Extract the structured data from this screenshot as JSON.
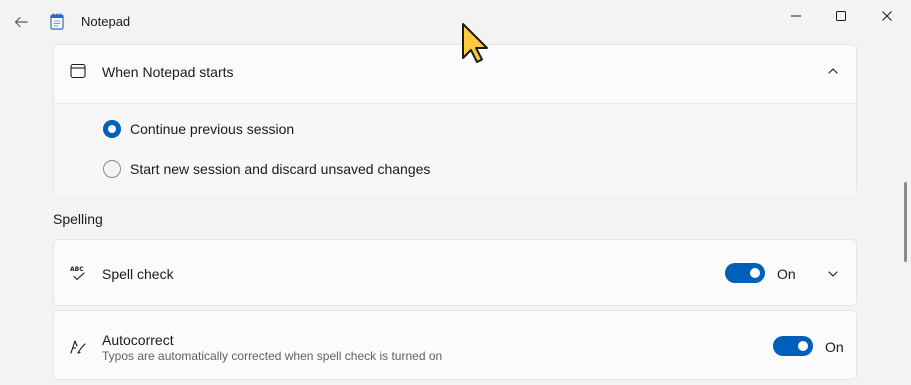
{
  "window": {
    "title": "Notepad",
    "icons": {
      "back": "arrow-left-icon",
      "app": "notepad-icon",
      "minimize": "minimize-icon",
      "maximize": "maximize-icon",
      "close": "close-icon"
    }
  },
  "startup": {
    "title": "When Notepad starts",
    "icon": "window-icon",
    "expanded": true,
    "options": [
      {
        "label": "Continue previous session",
        "selected": true
      },
      {
        "label": "Start new session and discard unsaved changes",
        "selected": false
      }
    ]
  },
  "spelling": {
    "section_title": "Spelling",
    "spell_check": {
      "label": "Spell check",
      "icon": "spell-check-icon",
      "state": "On",
      "enabled": true
    },
    "autocorrect": {
      "label": "Autocorrect",
      "description": "Typos are automatically corrected when spell check is turned on",
      "icon": "autocorrect-icon",
      "state": "On",
      "enabled": true
    }
  },
  "colors": {
    "accent": "#005fb8",
    "background": "#f3f3f3",
    "card": "#fbfbfb",
    "cursor": "#ffc83d"
  }
}
